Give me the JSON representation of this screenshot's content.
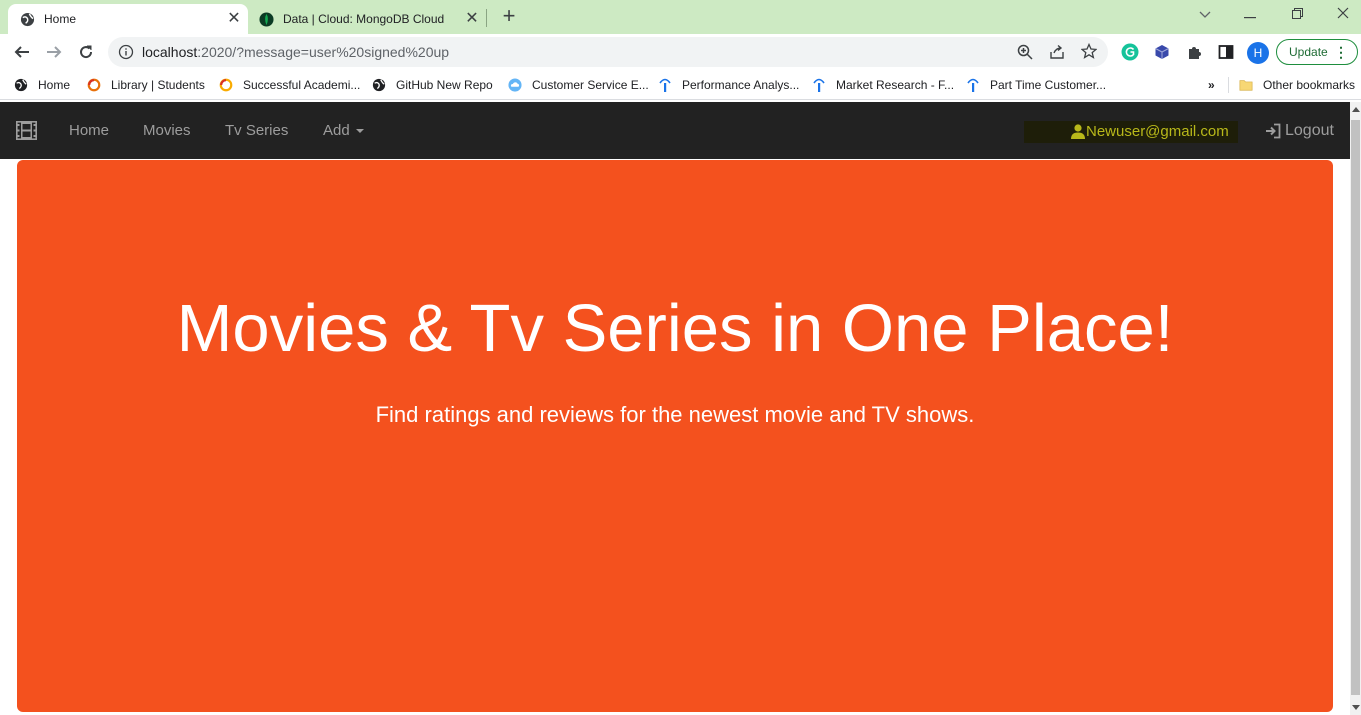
{
  "browser": {
    "tabs": [
      {
        "label": "Home",
        "active": true,
        "icon": "globe-icon"
      },
      {
        "label": "Data | Cloud: MongoDB Cloud",
        "active": false,
        "icon": "mongodb-leaf-icon"
      }
    ],
    "address_host": "localhost",
    "address_path": ":2020/?message=user%20signed%20up",
    "profile_initial": "H",
    "update_label": "Update",
    "bookmarks": [
      {
        "label": "Home",
        "icon": "globe-icon"
      },
      {
        "label": "Library | Students",
        "icon": "ring-icon"
      },
      {
        "label": "Successful Academi...",
        "icon": "ring-icon"
      },
      {
        "label": "GitHub New Repo",
        "icon": "globe-icon"
      },
      {
        "label": "Customer Service E...",
        "icon": "cloud-icon"
      },
      {
        "label": "Performance Analys...",
        "icon": "bookmark-i-icon"
      },
      {
        "label": "Market Research - F...",
        "icon": "bookmark-i-icon"
      },
      {
        "label": "Part Time Customer...",
        "icon": "bookmark-i-icon"
      }
    ],
    "more_bookmarks": "»",
    "other_bookmarks": "Other bookmarks"
  },
  "navbar": {
    "links": [
      "Home",
      "Movies",
      "Tv Series",
      "Add"
    ],
    "user_email": "Newuser@gmail.com",
    "logout_label": "Logout"
  },
  "hero": {
    "title": "Movies & Tv Series in One Place!",
    "subtitle": "Find ratings and reviews for the newest movie and TV shows."
  },
  "colors": {
    "tabstrip": "#cdeac3",
    "navbar": "#222222",
    "hero": "#f4511e",
    "user_text": "#b8b81a"
  }
}
